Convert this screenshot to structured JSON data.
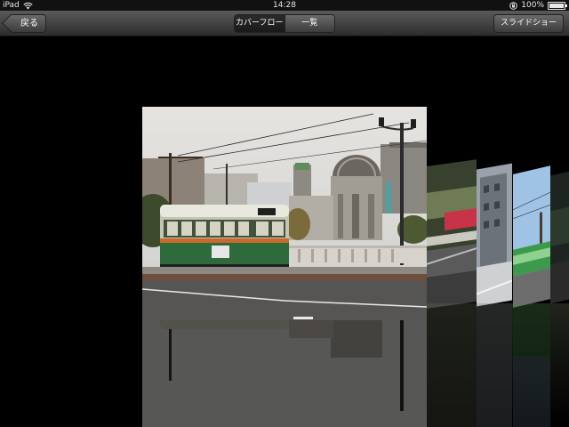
{
  "status_bar": {
    "device": "iPad",
    "time": "14:28",
    "battery": "100%",
    "wifi_icon": "wifi-icon",
    "lock_icon": "rotation-lock-icon"
  },
  "toolbar": {
    "back_label": "戻る",
    "segments": [
      {
        "label": "カバーフロー",
        "selected": true
      },
      {
        "label": "一覧",
        "selected": false
      }
    ],
    "slideshow_label": "スライドショー"
  },
  "viewer": {
    "mode": "cover-flow",
    "current_photo": "streetcar-and-dome",
    "side_photos": [
      "motion-blur-street",
      "building",
      "green-streetcar",
      "dark-photo"
    ]
  }
}
